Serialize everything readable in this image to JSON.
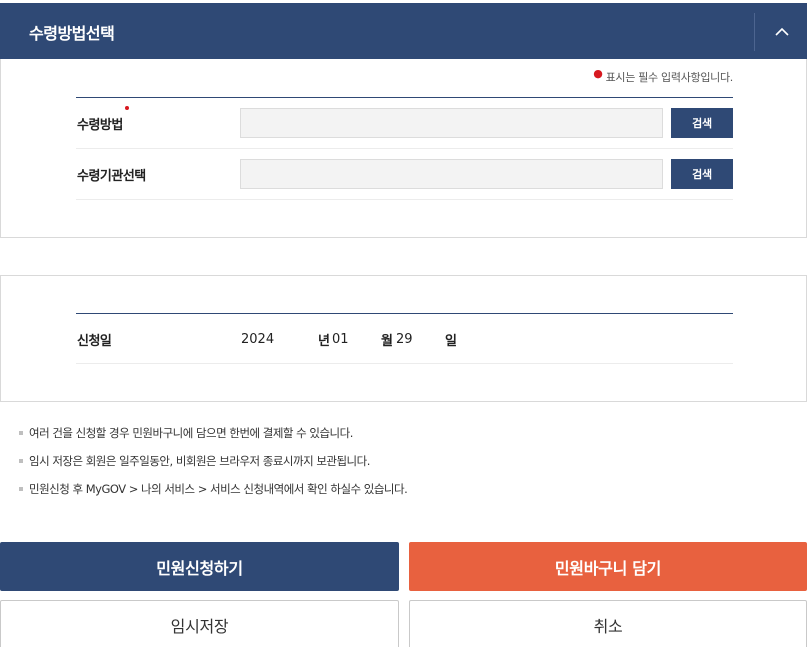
{
  "header": {
    "title": "수령방법선택",
    "collapse_icon": "chevron-up-icon"
  },
  "form": {
    "required_note": "표시는 필수 입력사항입니다.",
    "rows": [
      {
        "label": "수령방법",
        "required": true,
        "value": "",
        "button": "검색"
      },
      {
        "label": "수령기관선택",
        "required": false,
        "value": "",
        "button": "검색"
      }
    ]
  },
  "date": {
    "label": "신청일",
    "year": "2024",
    "year_unit": "년",
    "month": "01",
    "month_unit": "월",
    "day": "29",
    "day_unit": "일"
  },
  "notes": [
    "여러 건을 신청할 경우 민원바구니에 담으면 한번에 결제할 수 있습니다.",
    "임시 저장은 회원은 일주일동안, 비회원은 브라우저 종료시까지 보관됩니다.",
    "민원신청 후 MyGOV > 나의 서비스 > 서비스 신청내역에서 확인 하실수 있습니다."
  ],
  "buttons": {
    "apply": "민원신청하기",
    "cart": "민원바구니 담기",
    "temp_save": "임시저장",
    "cancel": "취소"
  },
  "colors": {
    "primary": "#2f4975",
    "accent": "#e8613f",
    "required": "#d71920"
  }
}
